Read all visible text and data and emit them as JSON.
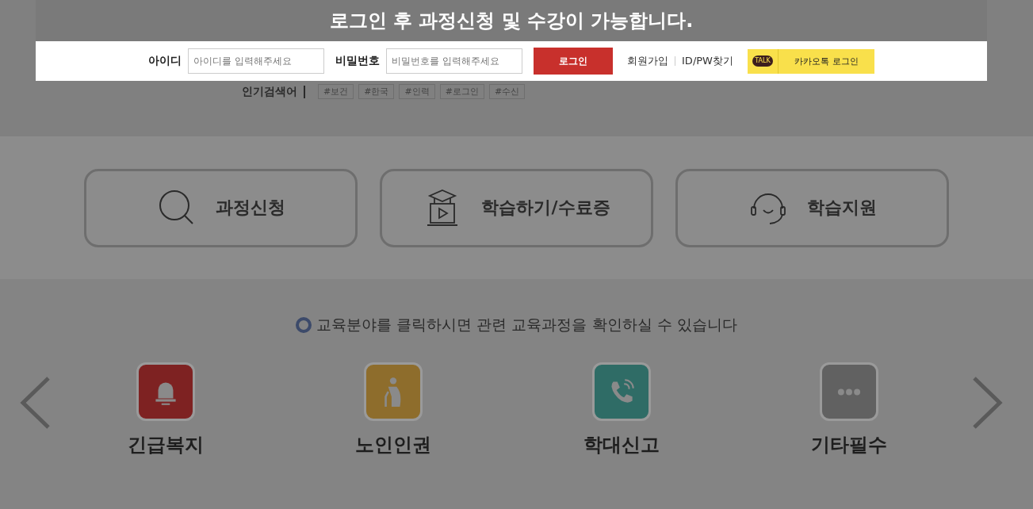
{
  "login_notice": {
    "title": "로그인 후 과정신청 및 수강이 가능합니다.",
    "id_label": "아이디",
    "id_field": {
      "placeholder": "아이디를 입력해주세요"
    },
    "password_label": "비밀번호",
    "password_field": {
      "placeholder": "비밀번호를 입력해주세요"
    },
    "login_button": "로그인",
    "links": [
      "회원가입",
      "ID/PW찾기"
    ],
    "kakao_button": {
      "icon_text": "TALK",
      "label": "카카오톡 로그인"
    }
  },
  "popular_search": {
    "label": "인기검색어",
    "tags": [
      "#보건",
      "#한국",
      "#인력",
      "#로그인",
      "#수신"
    ]
  },
  "quick_menu": [
    {
      "kind": "search",
      "label": "과정신청"
    },
    {
      "kind": "study",
      "label": "학습하기/수료증"
    },
    {
      "kind": "support",
      "label": "학습지원"
    }
  ],
  "category_notice": "교육분야를 클릭하시면 관련 교육과정을 확인하실 수 있습니다",
  "categories": [
    {
      "kind": "bell",
      "label": "긴급복지",
      "color": "#7e2222"
    },
    {
      "kind": "elder",
      "label": "노인인권",
      "color": "#8e6d2c"
    },
    {
      "kind": "phone",
      "label": "학대신고",
      "color": "#2f6c66"
    },
    {
      "kind": "more",
      "label": "기타필수",
      "color": "#616161"
    }
  ]
}
